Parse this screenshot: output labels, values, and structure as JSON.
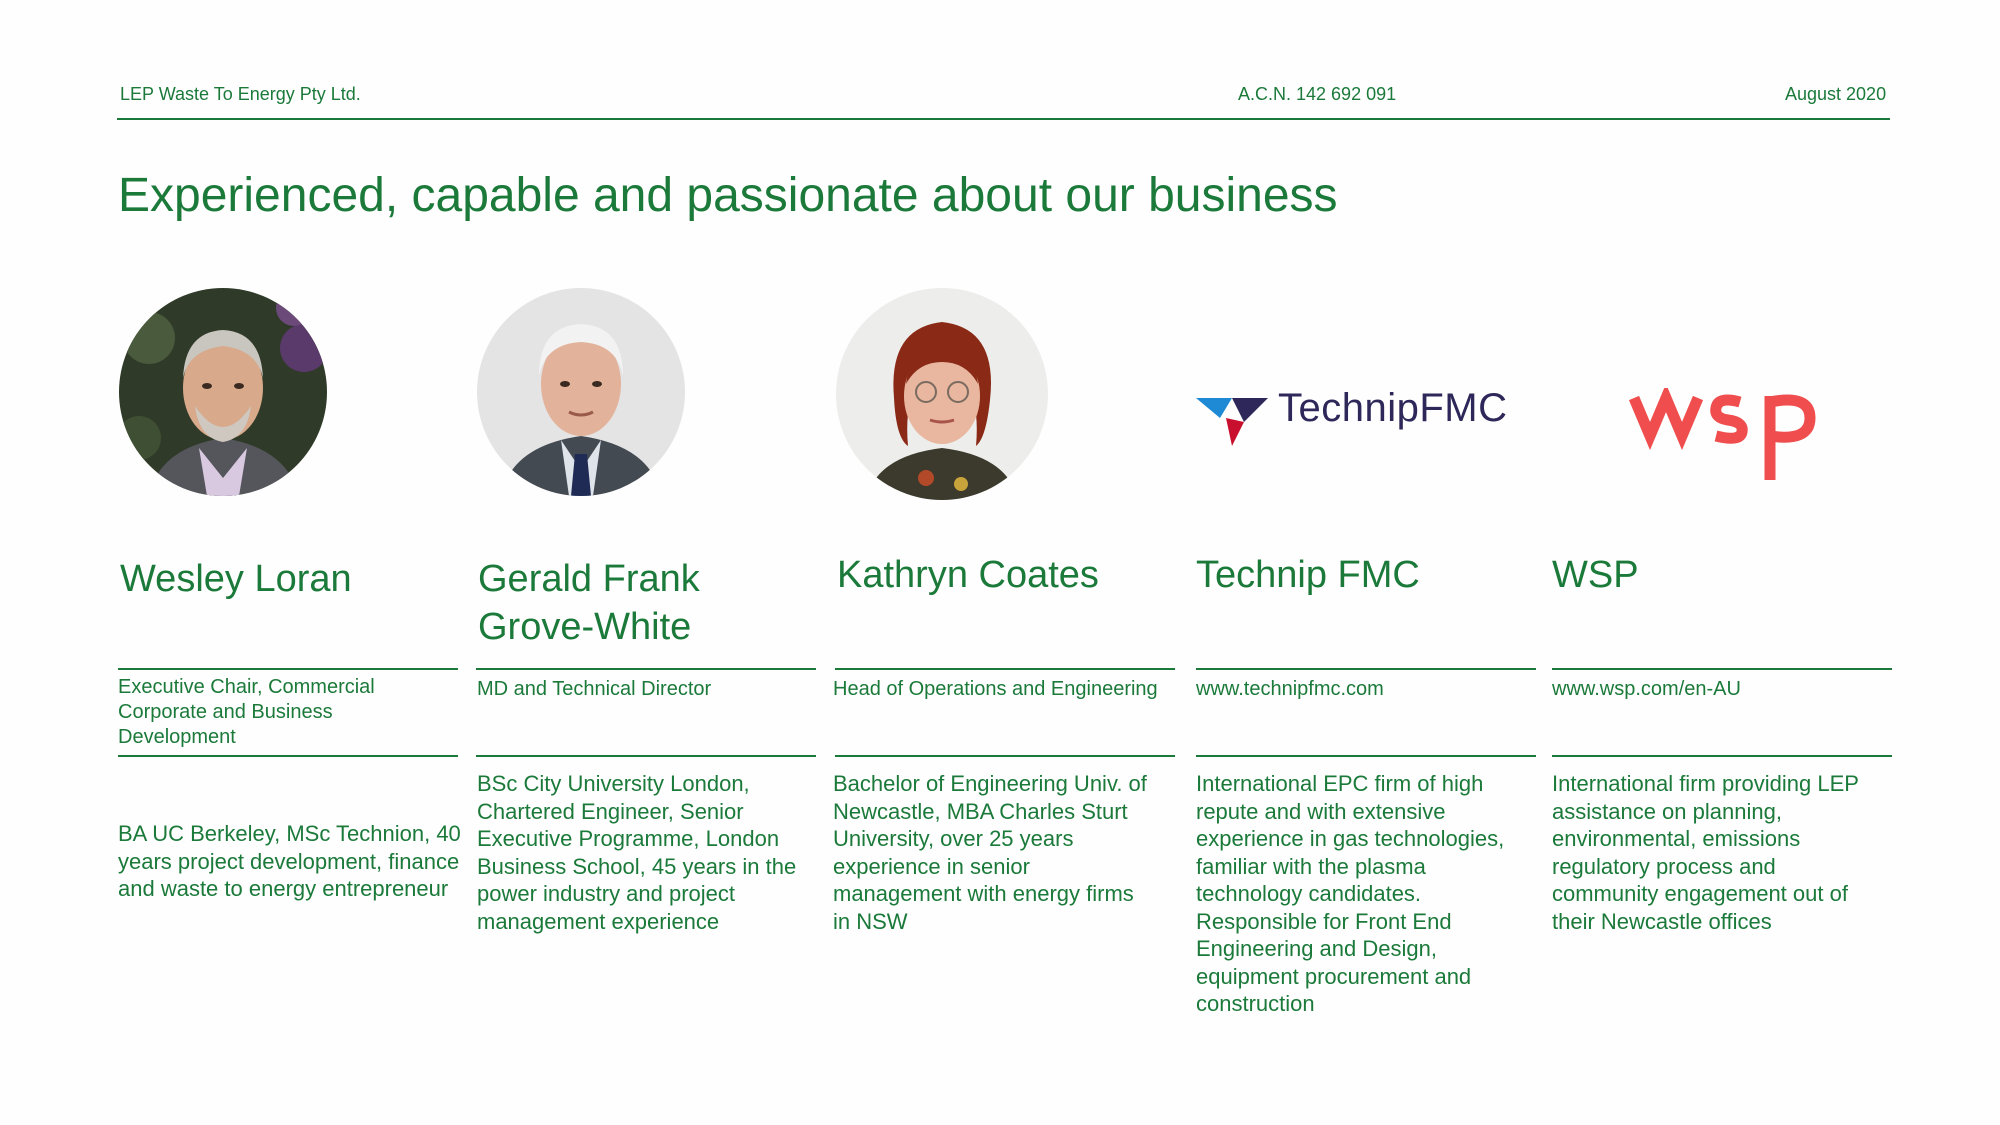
{
  "header": {
    "company": "LEP Waste To Energy Pty Ltd.",
    "acn": "A.C.N. 142 692 091",
    "date": "August 2020"
  },
  "title": "Experienced, capable and passionate about our business",
  "people": [
    {
      "name": "Wesley Loran",
      "role": "Executive Chair, Commercial Corporate and Business Development",
      "bio": "BA UC Berkeley, MSc Technion, 40 years project development, finance and waste to energy entrepreneur"
    },
    {
      "name": "Gerald Frank Grove-White",
      "role": "MD and Technical Director",
      "bio": "BSc City University London, Chartered Engineer, Senior Executive Programme, London Business School, 45 years in the power industry and project management experience"
    },
    {
      "name": "Kathryn Coates",
      "role": "Head of Operations and Engineering",
      "bio": "Bachelor of Engineering Univ. of Newcastle, MBA Charles Sturt University, over 25 years experience in senior management with energy firms in NSW"
    },
    {
      "name": "Technip FMC",
      "role": "www.technipfmc.com",
      "bio": "International EPC firm of high repute and with extensive experience in gas technologies, familiar with the plasma technology candidates. Responsible for Front End Engineering and Design, equipment procurement and construction",
      "logo_text": "TechnipFMC"
    },
    {
      "name": "WSP",
      "role": "www.wsp.com/en-AU",
      "bio": "International firm providing LEP assistance on planning, environmental, emissions regulatory process and community engagement out of their Newcastle offices",
      "logo_text": "wsp"
    }
  ],
  "colors": {
    "accent": "#1b7a3a",
    "technip_navy": "#2e2759",
    "technip_blue": "#1e8ad6",
    "technip_red": "#c8102e",
    "wsp_red": "#f04e4e"
  }
}
